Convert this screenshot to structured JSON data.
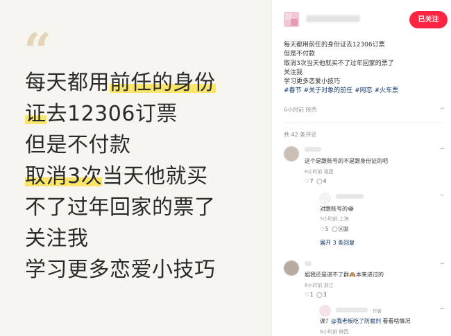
{
  "image_text": {
    "line1": "每天都用",
    "line1_hl": "前任的身份",
    "line2_hl": "证",
    "line2": "去12306订票",
    "line3": "但是不付款",
    "line4_hl": "取消3次",
    "line4": "当天他就买",
    "line5": "不了过年回家的票了",
    "line6": "关注我",
    "line7": "学习更多恋爱小技巧"
  },
  "header": {
    "follow_label": "已关注"
  },
  "post": {
    "lines": [
      "每天都用前任的身份证去12306订票",
      "但是不付款",
      "取消3次当天他就买不了过年回家的票了",
      "关注我",
      "学习更多恋爱小技巧"
    ],
    "tags": [
      "#春节",
      "#关于对象的前任",
      "#网恋",
      "#火车票"
    ],
    "meta": "6小时前 陕西"
  },
  "comments_count": "共 42 条评论",
  "comments": [
    {
      "text": "这个是跟账号的不是跟身份证的吧",
      "meta": "6小时前 福建",
      "likes": "7",
      "replies": "4"
    },
    {
      "text": "对跟账号的",
      "emoji": "😂",
      "meta": "5小时前 上海",
      "likes": "5",
      "reply_label": "回复"
    },
    {
      "text": "姐我还是进不了群",
      "emoji": "🙈",
      "text_after": "本来进过的",
      "meta": "6小时前 浙江",
      "likes": "1",
      "replies": "3"
    },
    {
      "text": "诶？",
      "mention": "@我老板吃了防腐剂",
      "text_after": "看看啥情况",
      "meta": "6小时前 陕西",
      "author_tag": "作者"
    }
  ],
  "expand_label": "展开 3 条回复",
  "icons": {
    "more": "more-dots-icon",
    "heart": "heart-icon",
    "comment": "comment-icon"
  },
  "colors": {
    "accent": "#ff2442",
    "tag": "#13386c",
    "highlight": "#f9e56a"
  }
}
